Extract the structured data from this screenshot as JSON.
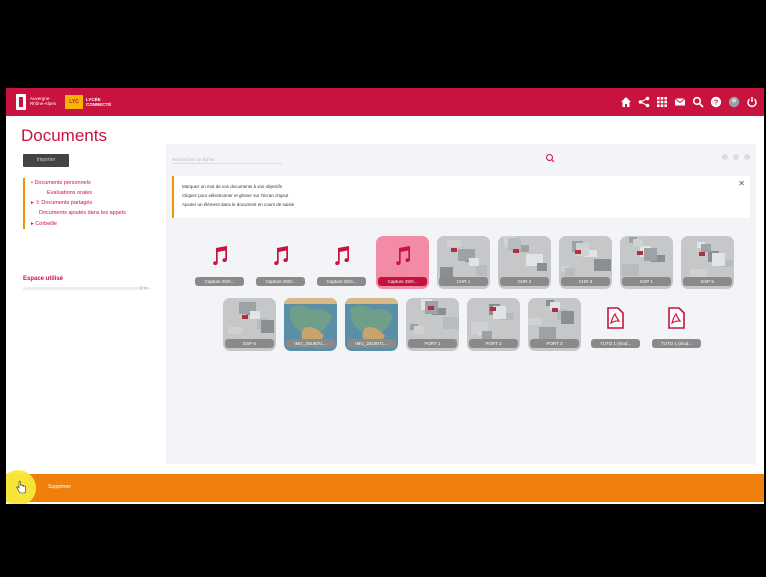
{
  "header": {
    "logo_region_text": "Auvergne-Rhône-Alpes",
    "logo_lyc_badge": "LYC",
    "logo_lyc_text": "LYCÉE CONNECTÉ",
    "icons": [
      "home-icon",
      "share-icon",
      "apps-icon",
      "mail-icon",
      "search-icon",
      "help-icon",
      "avatar-icon",
      "power-icon"
    ]
  },
  "page": {
    "title": "Documents"
  },
  "sidebar": {
    "import_label": "Importer",
    "tree": [
      {
        "label": "• Documents personnels",
        "level": "l1"
      },
      {
        "label": "Evaluations orales",
        "level": "l2"
      },
      {
        "label": "▸ ⇧ Documents partagés",
        "level": "l1"
      },
      {
        "label": "Documents ajoutés dans les appels",
        "level": "l1b"
      },
      {
        "label": "▸ Corbeille",
        "level": "l1"
      }
    ],
    "storage_label": "Espace utilisé",
    "storage_value": "0 %"
  },
  "toolbar": {
    "search_placeholder": "Rechercher un fichier"
  },
  "info": {
    "line1": "Marquez un mot de vos documents à vos objectifs",
    "line2": "Cliquez pour sélectionner et glisser sur l'écran d'ajout",
    "line3": "Ajouter un élément dans le document en cours de saisie"
  },
  "files": [
    {
      "name": "Capture 25/0...",
      "type": "audio",
      "selected": false
    },
    {
      "name": "Capture 25/0...",
      "type": "audio",
      "selected": false
    },
    {
      "name": "Capture 25/0...",
      "type": "audio",
      "selected": false
    },
    {
      "name": "Capture 25/0...",
      "type": "audio",
      "selected": true
    },
    {
      "name": "CHR 1",
      "type": "photo",
      "selected": false
    },
    {
      "name": "CHR 2",
      "type": "photo",
      "selected": false
    },
    {
      "name": "CHR 3",
      "type": "photo",
      "selected": false
    },
    {
      "name": "ESP 1",
      "type": "photo",
      "selected": false
    },
    {
      "name": "ESP 5",
      "type": "photo",
      "selected": false
    },
    {
      "name": "ESP 6",
      "type": "photo",
      "selected": false
    },
    {
      "name": "IMG_2019071...",
      "type": "map",
      "selected": false
    },
    {
      "name": "IMG_2019071...",
      "type": "map",
      "selected": false
    },
    {
      "name": "PORT 1",
      "type": "photo",
      "selected": false
    },
    {
      "name": "PORT 2",
      "type": "photo",
      "selected": false
    },
    {
      "name": "PORT 3",
      "type": "photo",
      "selected": false
    },
    {
      "name": "TUTO 1 (mod...",
      "type": "pdf",
      "selected": false
    },
    {
      "name": "TUTO 1 (mod...",
      "type": "pdf",
      "selected": false
    }
  ],
  "footer": {
    "label": "Supprimer"
  },
  "colors": {
    "brand": "#c8133f",
    "accent": "#f07f0c",
    "selected_tile": "#f48ba6"
  }
}
